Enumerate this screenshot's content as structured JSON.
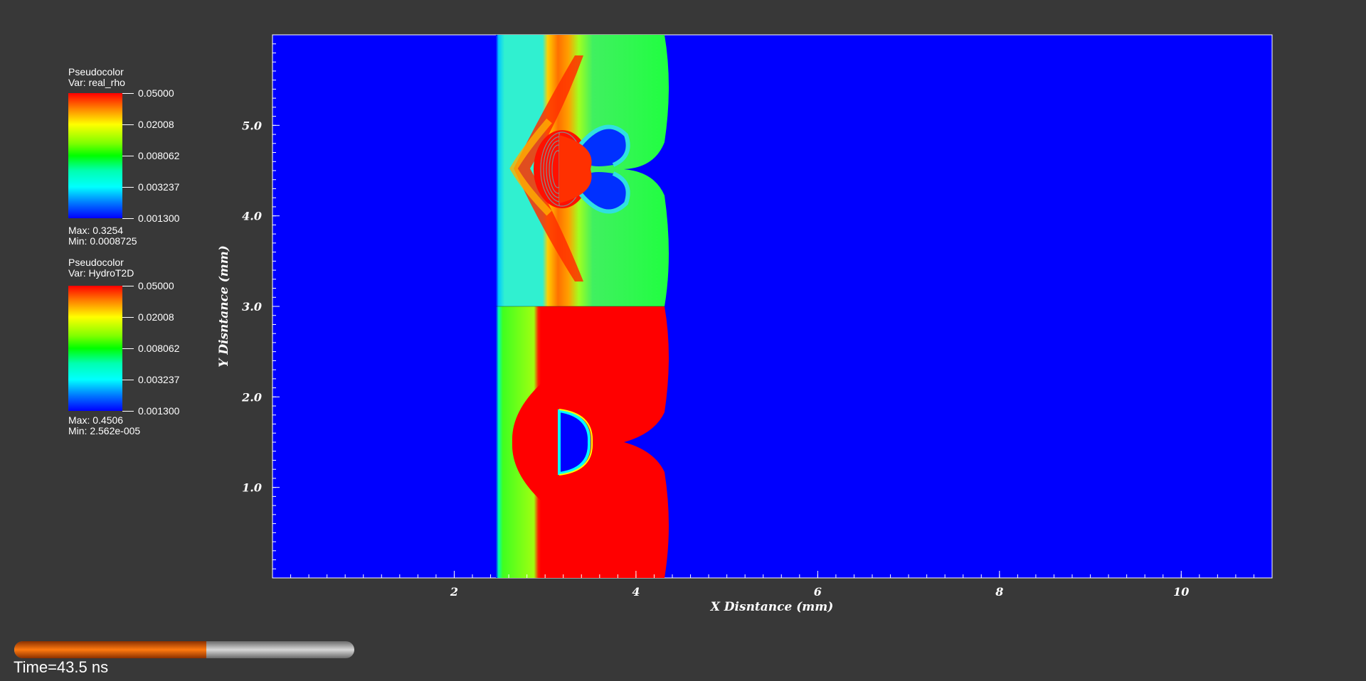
{
  "legends": [
    {
      "title": "Pseudocolor",
      "var": "Var: real_rho",
      "ticks": [
        "0.05000",
        "0.02008",
        "0.008062",
        "0.003237",
        "0.001300"
      ],
      "max": "Max:  0.3254",
      "min": "Min:  0.0008725"
    },
    {
      "title": "Pseudocolor",
      "var": "Var: HydroT2D",
      "ticks": [
        "0.05000",
        "0.02008",
        "0.008062",
        "0.003237",
        "0.001300"
      ],
      "max": "Max:  0.4506",
      "min": "Min:  2.562e-005"
    }
  ],
  "time_label": "Time=43.5 ns",
  "progress_fraction": 0.565,
  "chart_data": {
    "type": "heatmap",
    "xlabel": "X Disntance (mm)",
    "ylabel": "Y Disntance (mm)",
    "xlim": [
      0,
      11
    ],
    "ylim": [
      0,
      6
    ],
    "x_ticks": [
      2,
      4,
      6,
      8,
      10
    ],
    "x_tick_labels": [
      "2",
      "4",
      "6",
      "8",
      "10"
    ],
    "y_ticks": [
      1,
      2,
      3,
      4,
      5
    ],
    "y_tick_labels": [
      "1.0",
      "2.0",
      "3.0",
      "4.0",
      "5.0"
    ],
    "colormap": [
      "#0000ff",
      "#00ffff",
      "#00ff00",
      "#ffff00",
      "#ff0000"
    ],
    "panels": [
      {
        "name": "real_rho",
        "y_range": [
          3,
          6
        ],
        "x_range": [
          2.45,
          4.35
        ],
        "bubble_center": [
          3.2,
          4.5
        ]
      },
      {
        "name": "HydroT2D",
        "y_range": [
          0,
          3
        ],
        "x_range": [
          2.45,
          4.35
        ],
        "bubble_center": [
          3.2,
          1.5
        ]
      }
    ],
    "background_color": "#0000ff"
  }
}
